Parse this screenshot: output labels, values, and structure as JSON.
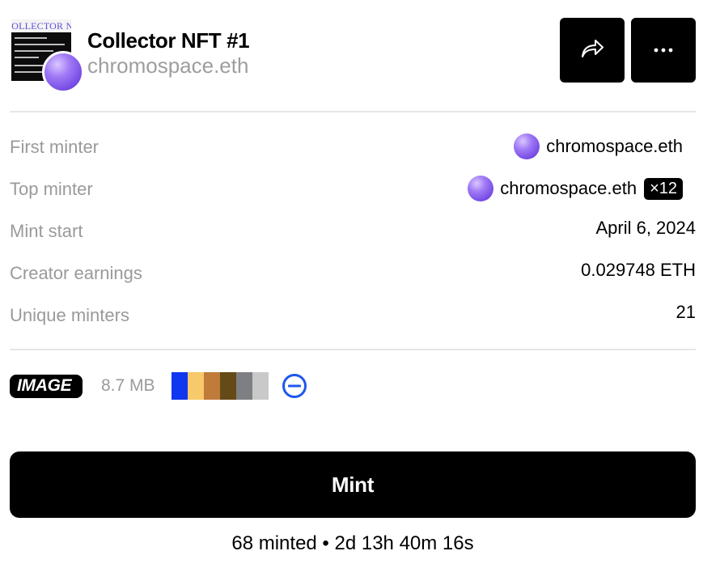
{
  "header": {
    "thumbnail_caption": "COLLECTOR N",
    "title": "Collector NFT #1",
    "creator": "chromospace.eth",
    "share_icon": "share-arrow-icon",
    "more_icon": "more-dots-icon"
  },
  "details": {
    "first_minter": {
      "label": "First minter",
      "value": "chromospace.eth"
    },
    "top_minter": {
      "label": "Top minter",
      "value": "chromospace.eth",
      "count": "×12"
    },
    "mint_start": {
      "label": "Mint start",
      "value": "April 6, 2024"
    },
    "creator_earnings": {
      "label": "Creator earnings",
      "value": "0.029748 ETH"
    },
    "unique_minters": {
      "label": "Unique minters",
      "value": "21"
    }
  },
  "media": {
    "type": "IMAGE",
    "size": "8.7 MB",
    "palette": [
      "#0f36f0",
      "#f7c96a",
      "#c07a3a",
      "#644a17",
      "#7e7f83",
      "#c9c9c9"
    ],
    "palette_icon": "blue-circle-minus-icon"
  },
  "mint": {
    "button_label": "Mint",
    "status": "68 minted • 2d 13h 40m 16s"
  }
}
